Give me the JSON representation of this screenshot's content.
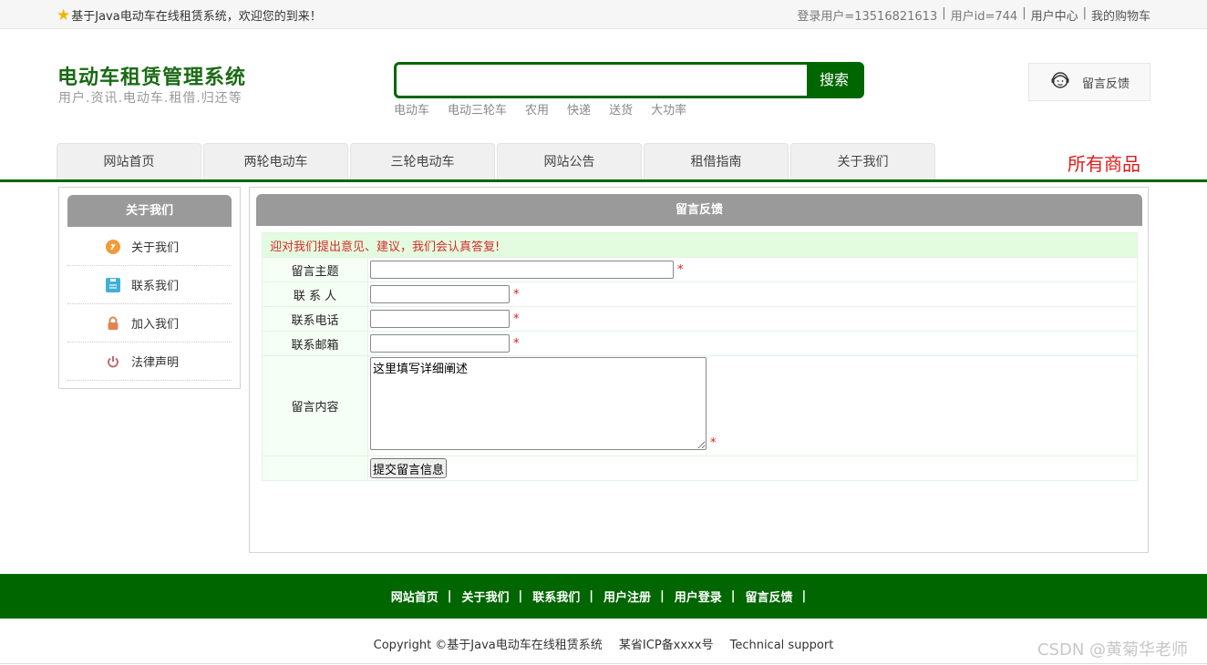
{
  "topbar": {
    "welcome": "基于Java电动车在线租赁系统，欢迎您的到来！",
    "login_user": "登录用户=13516821613",
    "user_id": "用户id=744",
    "user_center": "用户中心",
    "cart": "我的购物车",
    "separator": "|"
  },
  "brand": {
    "title": "电动车租赁管理系统",
    "subtitle": "用户.资讯.电动车.租借.归还等"
  },
  "search": {
    "value": "",
    "button": "搜索",
    "hotwords": [
      "电动车",
      "电动三轮车",
      "农用",
      "快递",
      "送货",
      "大功率"
    ]
  },
  "feedback_entry": {
    "label": "留言反馈"
  },
  "nav": {
    "items": [
      "网站首页",
      "两轮电动车",
      "三轮电动车",
      "网站公告",
      "租借指南",
      "关于我们"
    ],
    "all_goods": "所有商品"
  },
  "sidebar": {
    "title": "关于我们",
    "items": [
      {
        "label": "关于我们",
        "icon": "coin-icon",
        "color": "#f39a36"
      },
      {
        "label": "联系我们",
        "icon": "clipboard-icon",
        "color": "#3fb0d9"
      },
      {
        "label": "加入我们",
        "icon": "lock-icon",
        "color": "#e2834f"
      },
      {
        "label": "法律声明",
        "icon": "power-icon",
        "color": "#c46a6a"
      }
    ]
  },
  "main": {
    "title": "留言反馈",
    "notice": "迎对我们提出意见、建议，我们会认真答复!",
    "form": {
      "subject_label": "留言主题",
      "contact_label": "联 系 人",
      "phone_label": "联系电话",
      "email_label": "联系邮箱",
      "content_label": "留言内容",
      "content_value": "这里填写详细阐述",
      "required_mark": "*",
      "submit": "提交留言信息"
    }
  },
  "footer": {
    "links": [
      "网站首页",
      "关于我们",
      "联系我们",
      "用户注册",
      "用户登录",
      "留言反馈"
    ],
    "separator": "|",
    "copyright": "Copyright ©基于Java电动车在线租赁系统",
    "icp": "某省ICP备xxxx号",
    "support": "Technical support"
  },
  "watermark": "CSDN @黄菊华老师",
  "colors": {
    "brand_green": "#006600",
    "accent_red": "#e01b1b",
    "panel_gray": "#9a9a9a"
  }
}
